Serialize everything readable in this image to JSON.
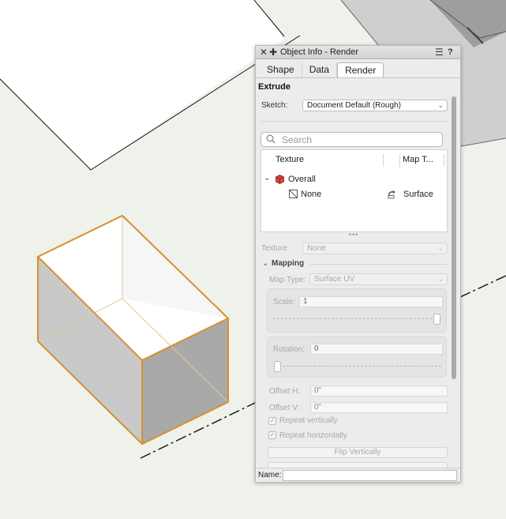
{
  "palette": {
    "title": "Object Info - Render",
    "tabs": [
      {
        "label": "Shape",
        "active": false
      },
      {
        "label": "Data",
        "active": false
      },
      {
        "label": "Render",
        "active": true
      }
    ],
    "section_title": "Extrude",
    "sketch": {
      "label": "Sketch:",
      "value": "Document Default (Rough)"
    },
    "search": {
      "placeholder": "Search"
    },
    "texture_table": {
      "columns": [
        "Texture",
        "Map T..."
      ],
      "rows": [
        {
          "name": "Overall",
          "map": ""
        },
        {
          "name": "None",
          "map": "Surface"
        }
      ]
    },
    "texture_field": {
      "label": "Texture:",
      "value": "None"
    },
    "mapping": {
      "title": "Mapping",
      "map_type": {
        "label": "Map Type:",
        "value": "Surface UV"
      },
      "scale": {
        "label": "Scale:",
        "value": "1",
        "slider_fraction": 1.0
      },
      "rotation": {
        "label": "Rotation:",
        "value": "0",
        "slider_fraction": 0.0
      },
      "offset_h": {
        "label": "Offset H:",
        "value": "0\""
      },
      "offset_v": {
        "label": "Offset V:",
        "value": "0\""
      },
      "repeat_vertically": {
        "label": "Repeat vertically",
        "checked": true
      },
      "repeat_horizontally": {
        "label": "Repeat horizontally",
        "checked": true
      },
      "flip_vertically_button": "Flip Vertically"
    },
    "name_field": {
      "label": "Name:",
      "value": ""
    }
  },
  "icons": {
    "close": "close-icon",
    "add": "plus-icon",
    "menu": "hamburger-menu-icon",
    "help": "help-icon",
    "search": "search-icon",
    "expand": "chevron-down-icon",
    "texture_cube": "texture-cube-icon",
    "no_texture": "no-texture-icon",
    "surface_map": "surface-mapping-icon"
  },
  "colors": {
    "selection_orange": "#d7902f",
    "canvas_background": "#eef2ea",
    "palette_background": "#ececec",
    "texture_cube_red": "#d8443c"
  }
}
